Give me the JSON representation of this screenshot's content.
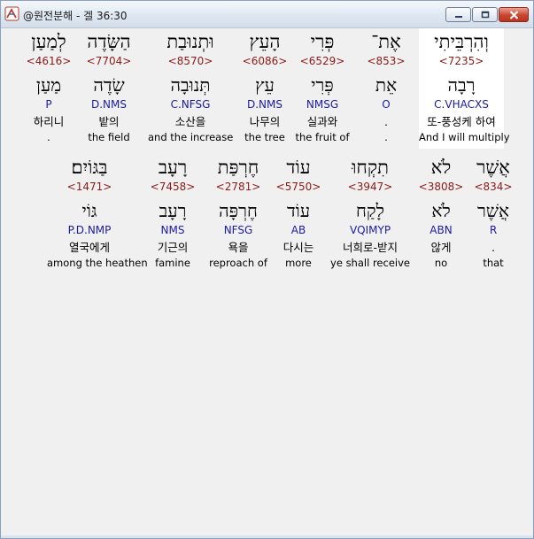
{
  "window": {
    "title": "@원전분해 - 겔 36:30",
    "controls": [
      "minimize-icon",
      "maximize-icon",
      "close-icon"
    ]
  },
  "colors": {
    "hebrew": "#000000",
    "strong": "#8b1a1a",
    "morph": "#1c1c9f",
    "gloss": "#000000",
    "highlight": "#ffffff"
  },
  "rows": [
    {
      "words": [
        {
          "hebrew": "וְהִרְבֵּיתִי",
          "strong": "<7235>",
          "lemma": "רָבָה",
          "morph": "C.VHACXS",
          "korean": "또-풍성케 하여",
          "english": "And I will multiply",
          "highlighted": true
        },
        {
          "hebrew": "אֶת־",
          "strong": "<853>",
          "lemma": "אֵת",
          "morph": "O",
          "korean": ".",
          "english": "."
        },
        {
          "hebrew": "פְּרִי",
          "strong": "<6529>",
          "lemma": "פְּרִי",
          "morph": "NMSG",
          "korean": "실과와",
          "english": "the fruit of"
        },
        {
          "hebrew": "הָעֵץ",
          "strong": "<6086>",
          "lemma": "עֵץ",
          "morph": "D.NMS",
          "korean": "나무의",
          "english": "the tree"
        },
        {
          "hebrew": "וּתְנוּבַת",
          "strong": "<8570>",
          "lemma": "תְּנוּבָה",
          "morph": "C.NFSG",
          "korean": "소산을",
          "english": "and the increase"
        },
        {
          "hebrew": "הַשָּׂדֶה",
          "strong": "<7704>",
          "lemma": "שָׂדֶה",
          "morph": "D.NMS",
          "korean": "밭의",
          "english": "the field"
        },
        {
          "hebrew": "לְמַעַן",
          "strong": "<4616>",
          "lemma": "מַעַן",
          "morph": "P",
          "korean": "하리니",
          "english": "."
        }
      ]
    },
    {
      "words": [
        {
          "hebrew": "אֲשֶׁר",
          "strong": "<834>",
          "lemma": "אֲשֶׁר",
          "morph": "R",
          "korean": ".",
          "english": "that"
        },
        {
          "hebrew": "לֹא",
          "strong": "<3808>",
          "lemma": "לֹא",
          "morph": "ABN",
          "korean": "않게",
          "english": "no"
        },
        {
          "hebrew": "תִקְחוּ",
          "strong": "<3947>",
          "lemma": "לָקַח",
          "morph": "VQIMYP",
          "korean": "너희로-받지",
          "english": "ye shall receive"
        },
        {
          "hebrew": "עוֹד",
          "strong": "<5750>",
          "lemma": "עוֹד",
          "morph": "AB",
          "korean": "다시는",
          "english": "more"
        },
        {
          "hebrew": "חֶרְפַּת",
          "strong": "<2781>",
          "lemma": "חֶרְפָּה",
          "morph": "NFSG",
          "korean": "욕을",
          "english": "reproach of"
        },
        {
          "hebrew": "רָעָב",
          "strong": "<7458>",
          "lemma": "רָעָב",
          "morph": "NMS",
          "korean": "기근의",
          "english": "famine"
        },
        {
          "hebrew": "בַּגּוֹיִם׃",
          "strong": "<1471>",
          "lemma": "גּוֹי",
          "morph": "P.D.NMP",
          "korean": "열국에게",
          "english": "among the heathen"
        }
      ]
    }
  ]
}
